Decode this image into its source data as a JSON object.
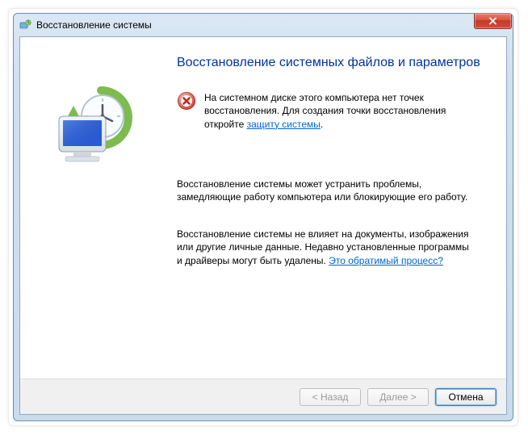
{
  "window": {
    "title": "Восстановление системы"
  },
  "heading": "Восстановление системных файлов и параметров",
  "error": {
    "text_before_link": "На системном диске этого компьютера нет точек восстановления. Для создания точки восстановления откройте ",
    "link": "защиту системы",
    "text_after_link": "."
  },
  "para1": "Восстановление системы может устранить проблемы, замедляющие работу компьютера или блокирующие его работу.",
  "para2": {
    "text_before_link": "Восстановление системы не влияет на документы, изображения или другие личные данные. Недавно установленные программы и драйверы могут быть удалены. ",
    "link": "Это обратимый процесс?"
  },
  "buttons": {
    "back": "< Назад",
    "next": "Далее >",
    "cancel": "Отмена"
  }
}
